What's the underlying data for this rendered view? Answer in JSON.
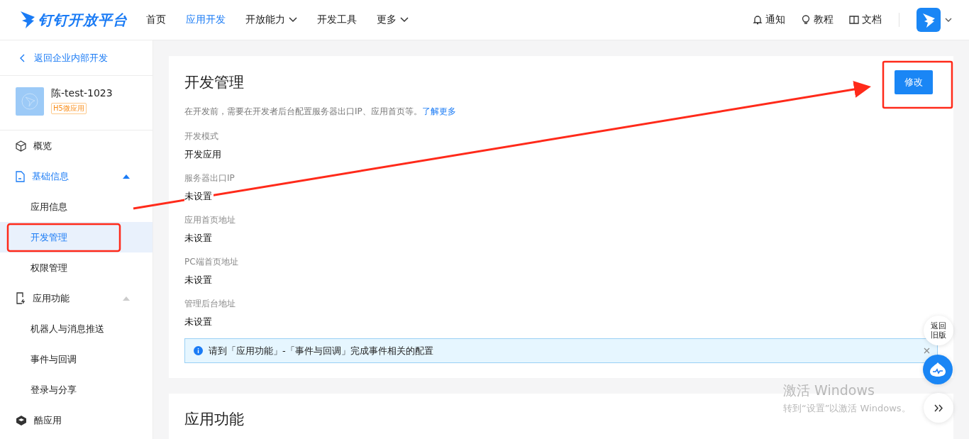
{
  "header": {
    "logo": "钉钉开放平台",
    "nav": [
      {
        "label": "首页",
        "selected": false,
        "dropdown": false
      },
      {
        "label": "应用开发",
        "selected": true,
        "dropdown": false
      },
      {
        "label": "开放能力",
        "selected": false,
        "dropdown": true
      },
      {
        "label": "开发工具",
        "selected": false,
        "dropdown": false
      },
      {
        "label": "更多",
        "selected": false,
        "dropdown": true
      }
    ],
    "links": [
      {
        "kind": "bell",
        "label": "通知"
      },
      {
        "kind": "bulb",
        "label": "教程"
      },
      {
        "kind": "book",
        "label": "文档"
      }
    ]
  },
  "sidebar": {
    "back": "返回企业内部开发",
    "app": {
      "name": "陈-test-1023",
      "tag": "H5微应用"
    },
    "items": [
      {
        "kind": "cube",
        "label": "概览",
        "selected": false
      },
      {
        "kind": "doc",
        "label": "基础信息",
        "selected": false,
        "active": true,
        "expanded": true,
        "children": [
          {
            "label": "应用信息",
            "selected": false
          },
          {
            "label": "开发管理",
            "selected": true
          },
          {
            "label": "权限管理",
            "selected": false
          }
        ]
      },
      {
        "kind": "phone",
        "label": "应用功能",
        "selected": false,
        "active": false,
        "expanded": true,
        "children": [
          {
            "label": "机器人与消息推送",
            "selected": false
          },
          {
            "label": "事件与回调",
            "selected": false
          },
          {
            "label": "登录与分享",
            "selected": false
          }
        ]
      },
      {
        "kind": "cool",
        "label": "酷应用",
        "selected": false
      }
    ]
  },
  "main": {
    "title": "开发管理",
    "edit_button": "修改",
    "description": "在开发前，需要在开发者后台配置服务器出口IP、应用首页等。",
    "learn_more": "了解更多",
    "fields": [
      {
        "label": "开发模式",
        "value": "开发应用"
      },
      {
        "label": "服务器出口IP",
        "value": "未设置"
      },
      {
        "label": "应用首页地址",
        "value": "未设置"
      },
      {
        "label": "PC端首页地址",
        "value": "未设置"
      },
      {
        "label": "管理后台地址",
        "value": "未设置"
      }
    ],
    "alert": "请到「应用功能」-「事件与回调」完成事件相关的配置",
    "next_section_title": "应用功能"
  },
  "floating": {
    "old_version": "返回旧版"
  },
  "activation": {
    "title": "激活 Windows",
    "hint": "转到“设置”以激活 Windows。"
  }
}
